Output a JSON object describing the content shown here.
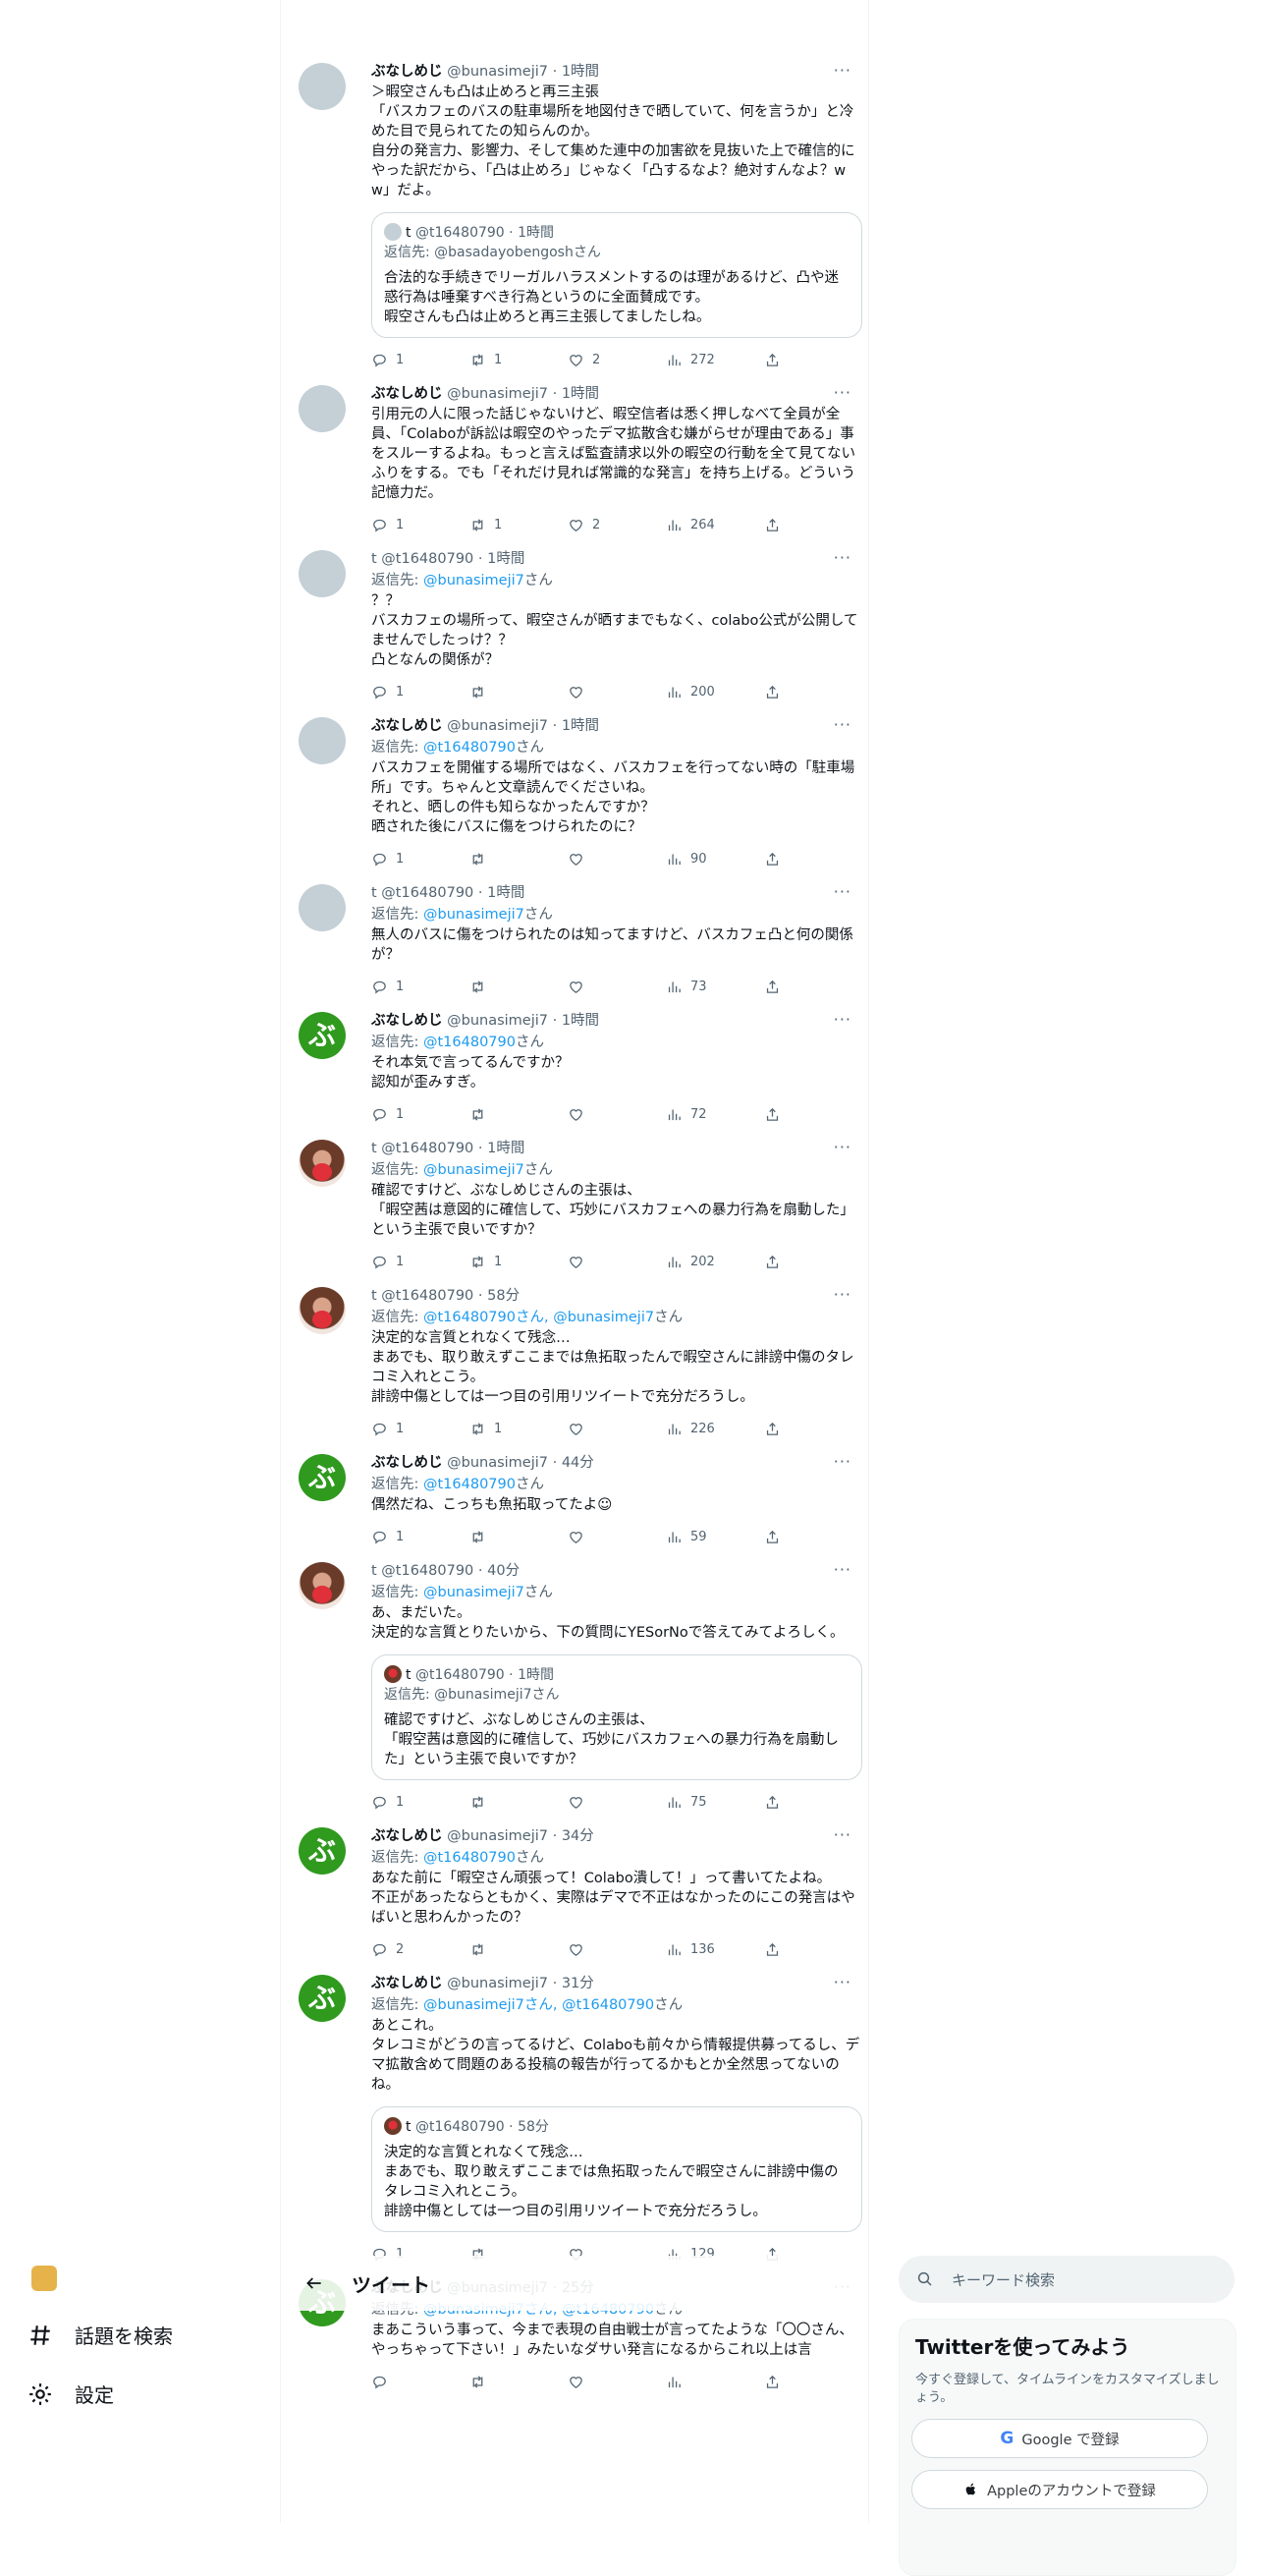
{
  "nav": {
    "explore_label": "話題を検索",
    "settings_label": "設定"
  },
  "header": {
    "title": "ツイート"
  },
  "search": {
    "placeholder": "キーワード検索"
  },
  "signup": {
    "title": "Twitterを使ってみよう",
    "desc": "今すぐ登録して、タイムラインをカスタマイズしましょう。",
    "google_label": "Google で登録",
    "apple_label": "Appleのアカウントで登録"
  },
  "tweets": [
    {
      "name": "ぶなしめじ",
      "handle": "@bunasimeji7",
      "time": "1時間",
      "reply_prefix": "",
      "reply_to": "",
      "text": "＞暇空さんも凸は止めろと再三主張\n「バスカフェのバスの駐車場所を地図付きで晒していて、何を言うか」と冷めた目で見られてたの知らんのか。\n自分の発言力、影響力、そして集めた連中の加害欲を見抜いた上で確信的にやった訳だから、「凸は止めろ」じゃなく「凸するなよ？絶対すんなよ？ww」だよ。",
      "quote": {
        "name": "t",
        "handle": "@t16480790",
        "time": "1時間",
        "reply": "返信先: @basadayobengoshさん",
        "text": "合法的な手続きでリーガルハラスメントするのは理があるけど、凸や迷惑行為は唾棄すべき行為というのに全面賛成です。\n暇空さんも凸は止めろと再三主張してましたしね。"
      },
      "replies": "1",
      "retweets": "1",
      "likes": "2",
      "views": "272"
    },
    {
      "name": "ぶなしめじ",
      "handle": "@bunasimeji7",
      "time": "1時間",
      "reply_prefix": "",
      "reply_to": "",
      "text": "引用元の人に限った話じゃないけど、暇空信者は悉く押しなべて全員が全員、「Colaboが訴訟は暇空のやったデマ拡散含む嫌がらせが理由である」事をスルーするよね。もっと言えば監査請求以外の暇空の行動を全て見てないふりをする。でも「それだけ見れば常識的な発言」を持ち上げる。どういう記憶力だ。",
      "replies": "1",
      "retweets": "1",
      "likes": "2",
      "views": "264"
    },
    {
      "name": "",
      "handle": "t @t16480790",
      "time": "1時間",
      "reply_prefix": "返信先: ",
      "reply_to": "@bunasimeji7",
      "text": "？？\nバスカフェの場所って、暇空さんが晒すまでもなく、colabo公式が公開してませんでしたっけ？？\n凸となんの関係が？",
      "replies": "1",
      "retweets": "",
      "likes": "",
      "views": "200"
    },
    {
      "name": "ぶなしめじ",
      "handle": "@bunasimeji7",
      "time": "1時間",
      "reply_prefix": "返信先: ",
      "reply_to": "@t16480790",
      "text": "バスカフェを開催する場所ではなく、バスカフェを行ってない時の「駐車場所」です。ちゃんと文章読んでくださいね。\nそれと、晒しの件も知らなかったんですか？\n晒された後にバスに傷をつけられたのに？",
      "replies": "1",
      "retweets": "",
      "likes": "",
      "views": "90"
    },
    {
      "name": "",
      "handle": "t @t16480790",
      "time": "1時間",
      "reply_prefix": "返信先: ",
      "reply_to": "@bunasimeji7",
      "text": "無人のバスに傷をつけられたのは知ってますけど、バスカフェ凸と何の関係が？",
      "replies": "1",
      "retweets": "",
      "likes": "",
      "views": "73"
    },
    {
      "name": "ぶなしめじ",
      "handle": "@bunasimeji7",
      "time": "1時間",
      "reply_prefix": "返信先: ",
      "reply_to": "@t16480790",
      "text": "それ本気で言ってるんですか？\n認知が歪みすぎ。",
      "replies": "1",
      "retweets": "",
      "likes": "",
      "views": "72"
    },
    {
      "name": "",
      "handle": "t @t16480790",
      "time": "1時間",
      "reply_prefix": "返信先: ",
      "reply_to": "@bunasimeji7",
      "text": "確認ですけど、ぶなしめじさんの主張は、\n「暇空茜は意図的に確信して、巧妙にバスカフェへの暴力行為を扇動した」という主張で良いですか？",
      "replies": "1",
      "retweets": "1",
      "likes": "",
      "views": "202"
    },
    {
      "name": "",
      "handle": "t @t16480790",
      "time": "58分",
      "reply_prefix": "返信先: ",
      "reply_to": "@t16480790さん, @bunasimeji7",
      "text": "決定的な言質とれなくて残念…\nまあでも、取り敢えずここまでは魚拓取ったんで暇空さんに誹謗中傷のタレコミ入れとこう。\n誹謗中傷としては一つ目の引用リツイートで充分だろうし。",
      "replies": "1",
      "retweets": "1",
      "likes": "",
      "views": "226"
    },
    {
      "name": "ぶなしめじ",
      "handle": "@bunasimeji7",
      "time": "44分",
      "reply_prefix": "返信先: ",
      "reply_to": "@t16480790",
      "text": "偶然だね、こっちも魚拓取ってたよ☺",
      "replies": "1",
      "retweets": "",
      "likes": "",
      "views": "59"
    },
    {
      "name": "",
      "handle": "t @t16480790",
      "time": "40分",
      "reply_prefix": "返信先: ",
      "reply_to": "@bunasimeji7",
      "text": "あ、まだいた。\n決定的な言質とりたいから、下の質問にYESorNoで答えてみてよろしく。",
      "quote": {
        "name": "t",
        "handle": "@t16480790",
        "time": "1時間",
        "reply": "返信先: @bunasimeji7さん",
        "text": "確認ですけど、ぶなしめじさんの主張は、\n「暇空茜は意図的に確信して、巧妙にバスカフェへの暴力行為を扇動した」という主張で良いですか？"
      },
      "replies": "1",
      "retweets": "",
      "likes": "",
      "views": "75"
    },
    {
      "name": "ぶなしめじ",
      "handle": "@bunasimeji7",
      "time": "34分",
      "reply_prefix": "返信先: ",
      "reply_to": "@t16480790",
      "text": "あなた前に「暇空さん頑張って！Colabo潰して！」って書いてたよね。\n不正があったならともかく、実際はデマで不正はなかったのにこの発言はやばいと思わんかったの？",
      "replies": "2",
      "retweets": "",
      "likes": "",
      "views": "136"
    },
    {
      "name": "ぶなしめじ",
      "handle": "@bunasimeji7",
      "time": "31分",
      "reply_prefix": "返信先: ",
      "reply_to": "@bunasimeji7さん, @t16480790",
      "text": "あとこれ。\nタレコミがどうの言ってるけど、Colaboも前々から情報提供募ってるし、デマ拡散含めて問題のある投稿の報告が行ってるかもとか全然思ってないのね。",
      "quote": {
        "name": "t",
        "handle": "@t16480790",
        "time": "58分",
        "reply": "",
        "text": "決定的な言質とれなくて残念…\nまあでも、取り敢えずここまでは魚拓取ったんで暇空さんに誹謗中傷のタレコミ入れとこう。\n誹謗中傷としては一つ目の引用リツイートで充分だろうし。"
      },
      "replies": "1",
      "retweets": "",
      "likes": "",
      "views": "129"
    },
    {
      "name": "ぶなしめじ",
      "handle": "@bunasimeji7",
      "time": "25分",
      "reply_prefix": "返信先: ",
      "reply_to": "@bunasimeji7さん, @t16480790",
      "text": "まあこういう事って、今まで表現の自由戦士が言ってたような「〇〇さん、やっちゃって下さい！」みたいなダサい発言になるからこれ以上は言",
      "replies": "",
      "retweets": "",
      "likes": "",
      "views": ""
    }
  ]
}
